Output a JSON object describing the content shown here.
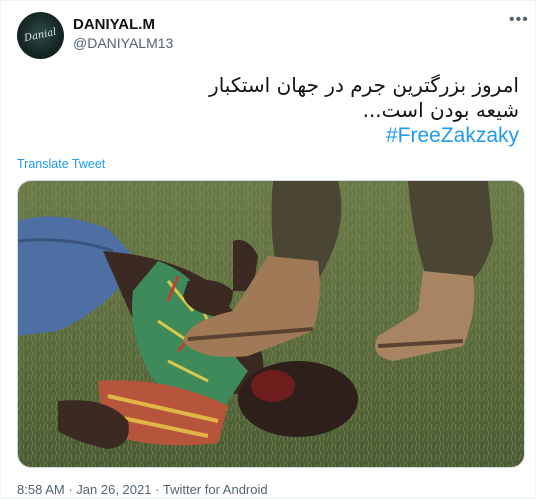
{
  "tweet": {
    "display_name": "DANIYAL.M",
    "handle": "@DANIYALM13",
    "avatar_text": "Danial",
    "more_icon": "ellipsis-icon",
    "text_lines": [
      "امروز بزرگترین جرم در جهان استکبار",
      "شیعه بودن است..."
    ],
    "hashtag": "#FreeZakzaky",
    "translate_label": "Translate Tweet",
    "time": "8:58 AM",
    "date": "Jan 26, 2021",
    "source": "Twitter for Android",
    "separator": "·"
  },
  "colors": {
    "link": "#1d9bf0",
    "secondary": "#536471",
    "text": "#0f1419"
  }
}
